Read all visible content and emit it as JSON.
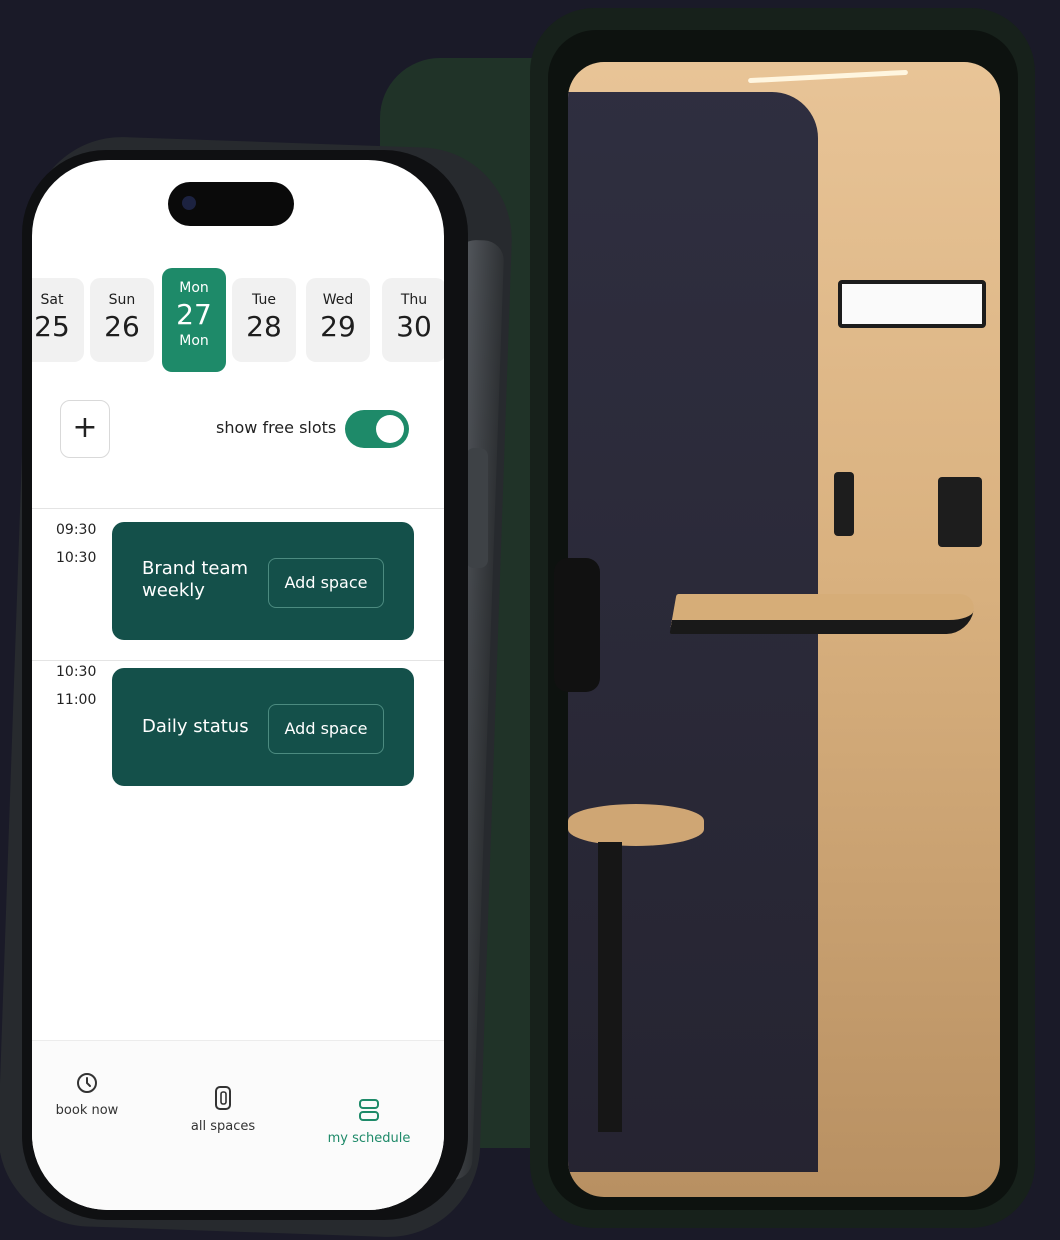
{
  "days": [
    {
      "name": "Sat",
      "num": "25"
    },
    {
      "name": "Sun",
      "num": "26"
    },
    {
      "name": "Mon",
      "num": "27",
      "sub": "Mon",
      "selected": true
    },
    {
      "name": "Tue",
      "num": "28"
    },
    {
      "name": "Wed",
      "num": "29"
    },
    {
      "name": "Thu",
      "num": "30"
    }
  ],
  "controls": {
    "add_symbol": "+",
    "free_slots_label": "show free slots",
    "free_slots_on": true
  },
  "events": [
    {
      "start": "09:30",
      "end": "10:30",
      "title": "Brand team weekly",
      "action": "Add space"
    },
    {
      "start": "10:30",
      "end": "11:00",
      "title": "Daily status",
      "action": "Add space"
    }
  ],
  "nav": [
    {
      "label": "book now",
      "icon": "clock-icon"
    },
    {
      "label": "all spaces",
      "icon": "phone-booth-icon"
    },
    {
      "label": "my schedule",
      "icon": "schedule-icon",
      "active": true
    }
  ],
  "colors": {
    "accent": "#1e8a69",
    "event_bg": "#14504a",
    "page_bg": "#1a1a28"
  }
}
